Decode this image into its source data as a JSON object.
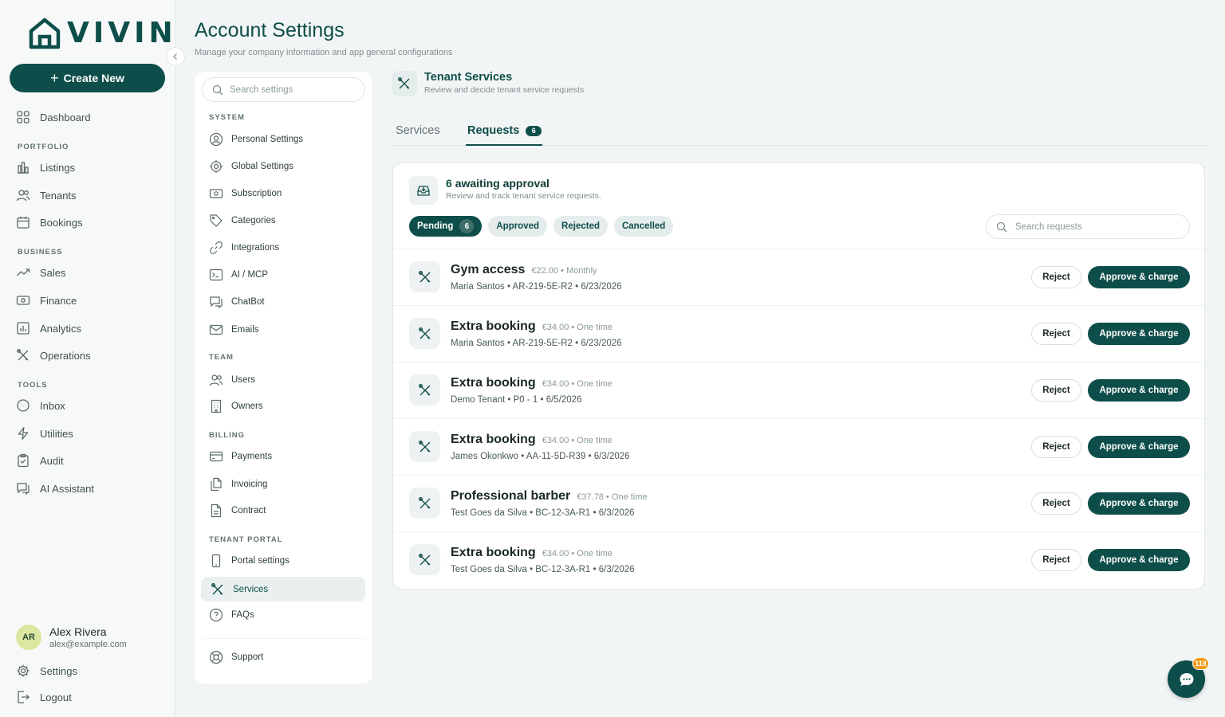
{
  "brand": {
    "name": "VIVIN",
    "accent": "#0e4e4a"
  },
  "sidebar": {
    "create_label": "Create New",
    "sections": {
      "portfolio": "PORTFOLIO",
      "business": "BUSINESS",
      "tools": "TOOLS"
    },
    "items": {
      "dashboard": "Dashboard",
      "listings": "Listings",
      "tenants": "Tenants",
      "bookings": "Bookings",
      "sales": "Sales",
      "finance": "Finance",
      "analytics": "Analytics",
      "operations": "Operations",
      "inbox": "Inbox",
      "utilities": "Utilities",
      "audit": "Audit",
      "ai_assistant": "AI Assistant"
    },
    "user": {
      "initials": "AR",
      "name": "Alex Rivera",
      "email": "alex@example.com"
    },
    "settings_label": "Settings",
    "logout_label": "Logout"
  },
  "header": {
    "title": "Account Settings",
    "subtitle": "Manage your company information and app general configurations"
  },
  "settings_nav": {
    "search_placeholder": "Search settings",
    "system": {
      "label": "SYSTEM",
      "personal": "Personal Settings",
      "global": "Global Settings",
      "subscription": "Subscription",
      "categories": "Categories",
      "integrations": "Integrations",
      "ai_mcp": "AI / MCP",
      "chatbot": "ChatBot",
      "emails": "Emails"
    },
    "team": {
      "label": "TEAM",
      "users": "Users",
      "owners": "Owners"
    },
    "billing": {
      "label": "BILLING",
      "payments": "Payments",
      "invoicing": "Invoicing",
      "contract": "Contract"
    },
    "tenant_portal": {
      "label": "TENANT PORTAL",
      "portal_settings": "Portal settings",
      "services": "Services",
      "faqs": "FAQs"
    },
    "support": "Support"
  },
  "section": {
    "title": "Tenant Services",
    "subtitle": "Review and decide tenant service requests",
    "tabs": {
      "services": "Services",
      "requests": "Requests",
      "requests_count": "6"
    }
  },
  "card": {
    "count": "6",
    "title_suffix": "awaiting approval",
    "subtitle": "Review and track tenant service requests.",
    "filters": {
      "pending": "Pending",
      "pending_count": "6",
      "approved": "Approved",
      "rejected": "Rejected",
      "cancelled": "Cancelled"
    },
    "search_placeholder": "Search requests",
    "reject_label": "Reject",
    "approve_label": "Approve & charge",
    "requests": [
      {
        "name": "Gym access",
        "price": "€22.00 • Monthly",
        "meta": "Maria Santos • AR-219-5E-R2 • 6/23/2026"
      },
      {
        "name": "Extra booking",
        "price": "€34.00 • One time",
        "meta": "Maria Santos • AR-219-5E-R2 • 6/23/2026"
      },
      {
        "name": "Extra booking",
        "price": "€34.00 • One time",
        "meta": "Demo Tenant • P0 - 1 • 6/5/2026"
      },
      {
        "name": "Extra booking",
        "price": "€34.00 • One time",
        "meta": "James Okonkwo • AA-11-5D-R39 • 6/3/2026"
      },
      {
        "name": "Professional barber",
        "price": "€37.78 • One time",
        "meta": "Test Goes da Silva • BC-12-3A-R1 • 6/3/2026"
      },
      {
        "name": "Extra booking",
        "price": "€34.00 • One time",
        "meta": "Test Goes da Silva • BC-12-3A-R1 • 6/3/2026"
      }
    ]
  },
  "chat": {
    "badge": "118"
  }
}
